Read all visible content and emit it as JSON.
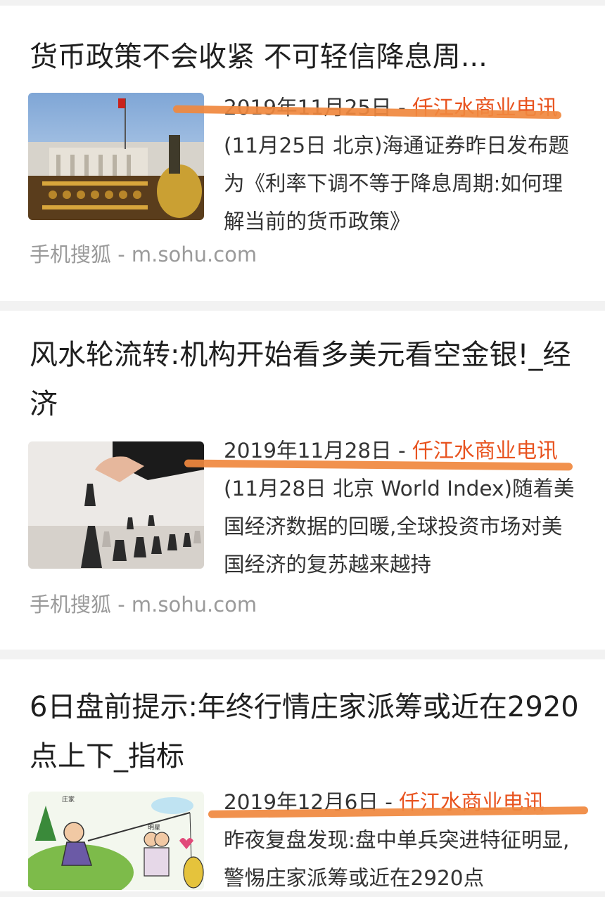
{
  "results": [
    {
      "title": "货币政策不会收紧 不可轻信降息周...",
      "date": "2019年11月25日 - ",
      "source_name": "仟江水商业电讯",
      "snippet": " (11月25日 北京)海通证券昨日发布题为《利率下调不等于降息周期:如何理解当前的货币政策》",
      "site": "手机搜狐 - m.sohu.com",
      "thumb_icon": "central-bank-abacus-image"
    },
    {
      "title": "风水轮流转:机构开始看多美元看空金银!_经济",
      "date": "2019年11月28日 - ",
      "source_name": "仟江水商业电讯",
      "snippet": " (11月28日 北京 World Index)随着美国经济数据的回暖,全球投资市场对美国经济的复苏越来越持",
      "site": "手机搜狐 - m.sohu.com",
      "thumb_icon": "chess-hand-image"
    },
    {
      "title": "6日盘前提示:年终行情庄家派筹或近在2920点上下_指标",
      "date": "2019年12月6日 - ",
      "source_name": "仟江水商业电讯",
      "snippet": "昨夜复盘发现:盘中单兵突进特征明显,警惕庄家派筹或近在2920点",
      "site": "",
      "thumb_icon": "cartoon-fishing-image",
      "thumb_labels": [
        "庄家",
        "明星"
      ]
    }
  ],
  "colors": {
    "accent": "#e8531f",
    "marker": "#f0883e",
    "site": "#9a9a9a"
  }
}
